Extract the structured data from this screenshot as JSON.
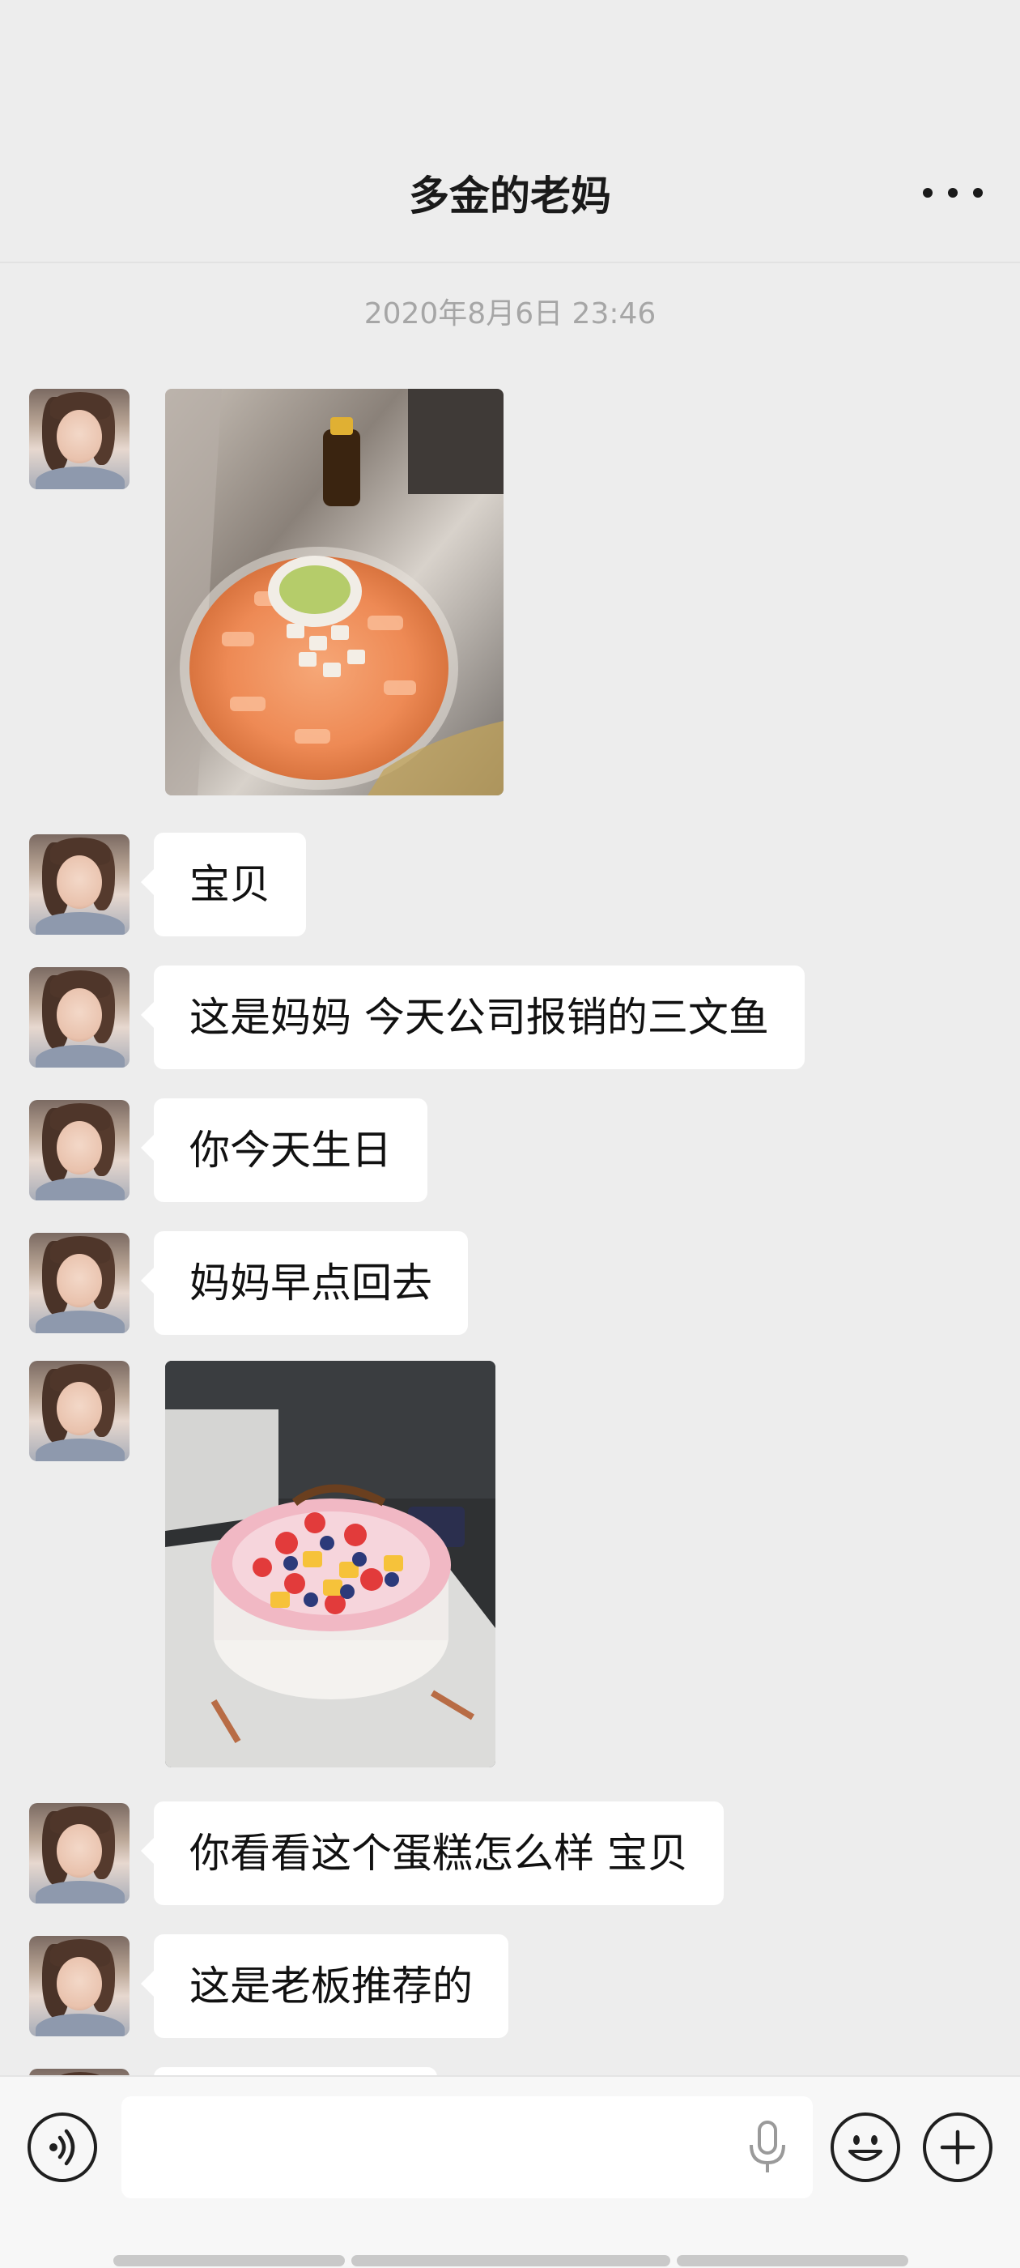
{
  "header": {
    "title": "多金的老妈"
  },
  "chat": {
    "timestamp": "2020年8月6日 23:46",
    "messages": [
      {
        "type": "image",
        "content": "salmon-sashimi-photo"
      },
      {
        "type": "text",
        "content": "宝贝"
      },
      {
        "type": "text",
        "content": "这是妈妈 今天公司报销的三文鱼"
      },
      {
        "type": "text",
        "content": "你今天生日"
      },
      {
        "type": "text",
        "content": "妈妈早点回去"
      },
      {
        "type": "image",
        "content": "fruit-cake-photo"
      },
      {
        "type": "text",
        "content": "你看看这个蛋糕怎么样 宝贝"
      },
      {
        "type": "text",
        "content": "这是老板推荐的"
      }
    ]
  },
  "input_bar": {
    "voice_icon": "voice-icon",
    "mic_icon": "microphone-icon",
    "emoji_icon": "emoji-icon",
    "plus_icon": "plus-icon",
    "input_value": ""
  },
  "colors": {
    "background": "#ededed",
    "bubble": "#ffffff",
    "timestamp_text": "#a6a6a6",
    "header_text": "#1a1a1a"
  }
}
